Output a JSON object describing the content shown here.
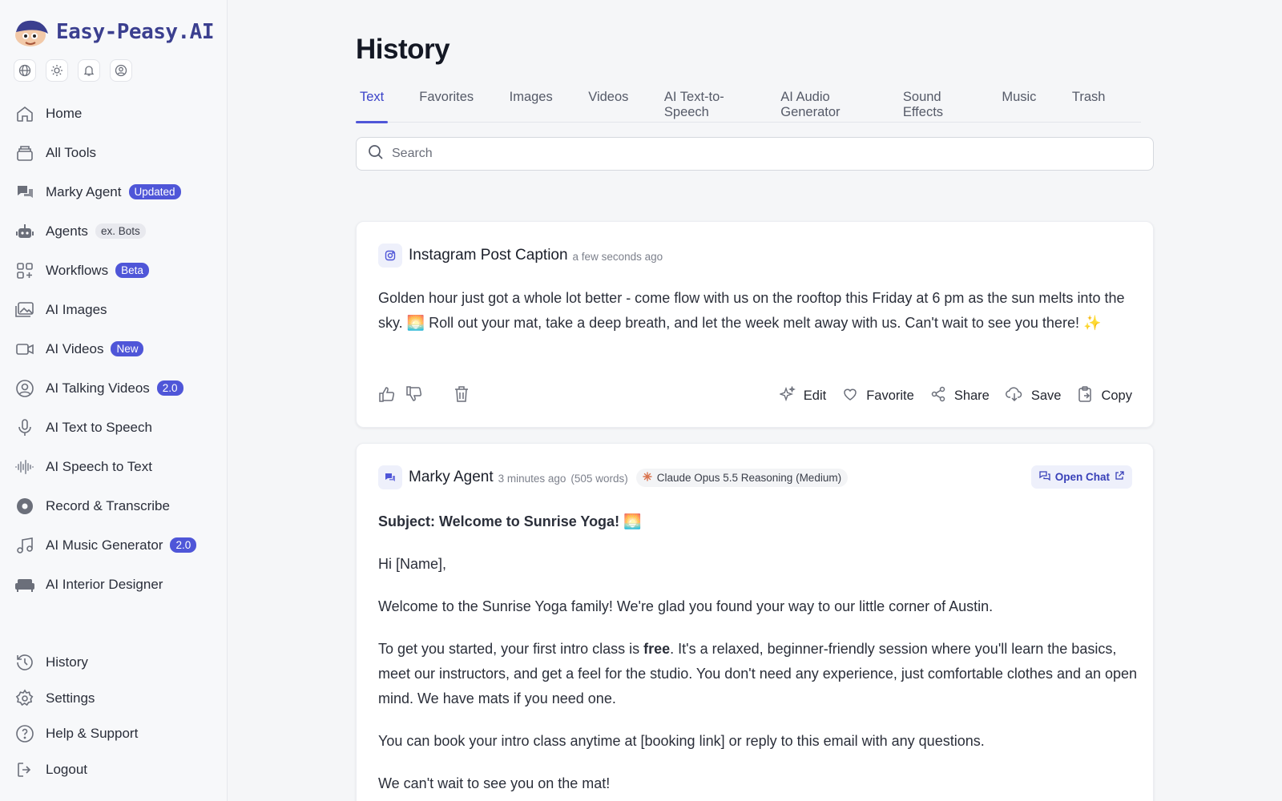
{
  "brand": {
    "name": "Easy-Peasy.AI"
  },
  "sidebar": {
    "quick_icons": [
      "globe-icon",
      "sun-icon",
      "bell-icon",
      "user-circle-icon"
    ],
    "items": [
      {
        "label": "Home",
        "icon": "home-icon"
      },
      {
        "label": "All Tools",
        "icon": "tools-icon"
      },
      {
        "label": "Marky Agent",
        "icon": "chat-icon",
        "badge": "Updated"
      },
      {
        "label": "Agents",
        "icon": "robot-icon",
        "badge": "ex. Bots"
      },
      {
        "label": "Workflows",
        "icon": "workflows-icon",
        "badge": "Beta"
      },
      {
        "label": "AI Images",
        "icon": "images-icon"
      },
      {
        "label": "AI Videos",
        "icon": "video-icon",
        "badge": "New"
      },
      {
        "label": "AI Talking Videos",
        "icon": "talking-icon",
        "badge": "2.0"
      },
      {
        "label": "AI Text to Speech",
        "icon": "microphone-icon"
      },
      {
        "label": "AI Speech to Text",
        "icon": "waveform-icon"
      },
      {
        "label": "Record & Transcribe",
        "icon": "record-icon"
      },
      {
        "label": "AI Music Generator",
        "icon": "music-icon",
        "badge": "2.0"
      },
      {
        "label": "AI Interior Designer",
        "icon": "sofa-icon"
      }
    ],
    "bottom": [
      {
        "label": "History",
        "icon": "history-icon"
      },
      {
        "label": "Settings",
        "icon": "gear-icon"
      },
      {
        "label": "Help & Support",
        "icon": "help-icon"
      },
      {
        "label": "Logout",
        "icon": "logout-icon"
      }
    ]
  },
  "main": {
    "title": "History",
    "tabs": [
      "Text",
      "Favorites",
      "Images",
      "Videos",
      "AI Text-to-Speech",
      "AI Audio Generator",
      "Sound Effects",
      "Music",
      "Trash"
    ],
    "active_tab": "Text",
    "search": {
      "placeholder": "Search",
      "value": ""
    },
    "cards": [
      {
        "tool": "Instagram Post Caption",
        "time": "a few seconds ago",
        "text": "Golden hour just got a whole lot better - come flow with us on the rooftop this Friday at 6 pm as the sun melts into the sky. 🌅 Roll out your mat, take a deep breath, and let the week melt away with us. Can't wait to see you there! ✨",
        "actions": [
          "Edit",
          "Favorite",
          "Share",
          "Save",
          "Copy"
        ]
      },
      {
        "tool": "Marky Agent",
        "time": "3 minutes ago",
        "words": "(505 words)",
        "model": "Claude Opus 5.5 Reasoning (Medium)",
        "open_chat": "Open Chat",
        "subject": "Subject: Welcome to Sunrise Yoga! 🌅",
        "greeting": "Hi [Name],",
        "p1": "Welcome to the Sunrise Yoga family! We're glad you found your way to our little corner of Austin.",
        "p2_a": "To get you started, your first intro class is ",
        "p2_b": "free",
        "p2_c": ". It's a relaxed, beginner-friendly session where you'll learn the basics, meet our instructors, and get a feel for the studio. You don't need any experience, just comfortable clothes and an open mind. We have mats if you need one.",
        "p3": "You can book your intro class anytime at [booking link] or reply to this email with any questions.",
        "p4": "We can't wait to see you on the mat!"
      }
    ]
  },
  "colors": {
    "accent": "#4f56d8",
    "brand_text": "#3b3f8f"
  }
}
